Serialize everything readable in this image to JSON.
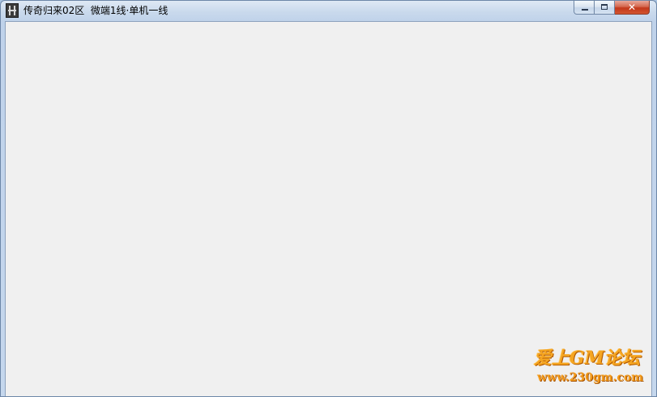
{
  "window": {
    "title": "传奇归来02区  微端1线·单机一线",
    "icon": "app-icon"
  },
  "caption_buttons": {
    "minimize_icon": "minimize-icon",
    "maximize_icon": "maximize-icon",
    "close_icon": "close-icon",
    "close_glyph": "✕"
  },
  "watermark": {
    "line1": "爱上GM论坛",
    "line2": "www.230gm.com"
  },
  "colors": {
    "client_background": "#f0f0f0",
    "close_button": "#c7391b",
    "watermark": "#f5a521"
  }
}
